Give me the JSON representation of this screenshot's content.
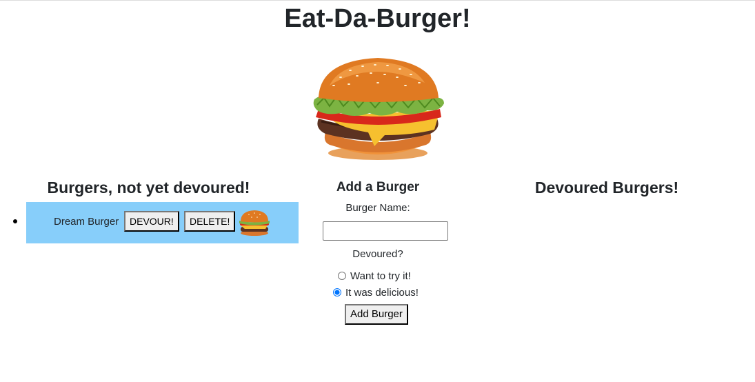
{
  "page": {
    "title": "Eat-Da-Burger!"
  },
  "hero_image": {
    "icon": "burger-illustration"
  },
  "not_devoured": {
    "heading": "Burgers, not yet devoured!",
    "items": [
      {
        "name": "Dream Burger",
        "devour_label": "DEVOUR!",
        "delete_label": "DELETE!",
        "icon": "burger-thumbnail",
        "background_color": "#87cefa"
      }
    ]
  },
  "add_form": {
    "heading": "Add a Burger",
    "name_label": "Burger Name:",
    "name_value": "",
    "devoured_label": "Devoured?",
    "options": [
      {
        "label": "Want to try it!",
        "selected": false
      },
      {
        "label": "It was delicious!",
        "selected": true
      }
    ],
    "submit_label": "Add Burger"
  },
  "devoured": {
    "heading": "Devoured Burgers!",
    "items": []
  }
}
